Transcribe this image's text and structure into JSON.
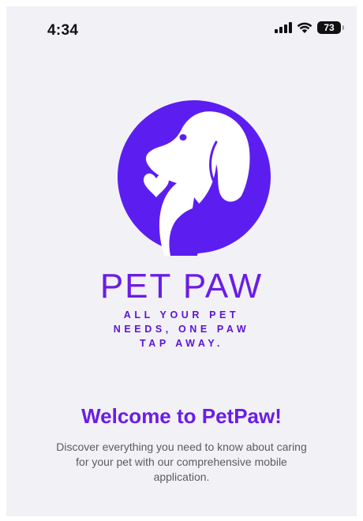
{
  "status_bar": {
    "time": "4:34",
    "battery_level": "73",
    "icons": [
      "cellular-signal-icon",
      "wifi-icon",
      "battery-icon"
    ]
  },
  "colors": {
    "brand_purple": "#6a1de6",
    "logo_circle": "#5c1ef0",
    "background": "#f2f1f6",
    "body_text": "#5c5c5c"
  },
  "logo": {
    "name": "PET PAW",
    "tagline_lines": [
      "ALL YOUR PET",
      "NEEDS, ONE PAW",
      "TAP AWAY."
    ]
  },
  "welcome": {
    "title": "Welcome to PetPaw!",
    "description": "Discover everything you need to know about caring for your pet with our comprehensive mobile application."
  }
}
